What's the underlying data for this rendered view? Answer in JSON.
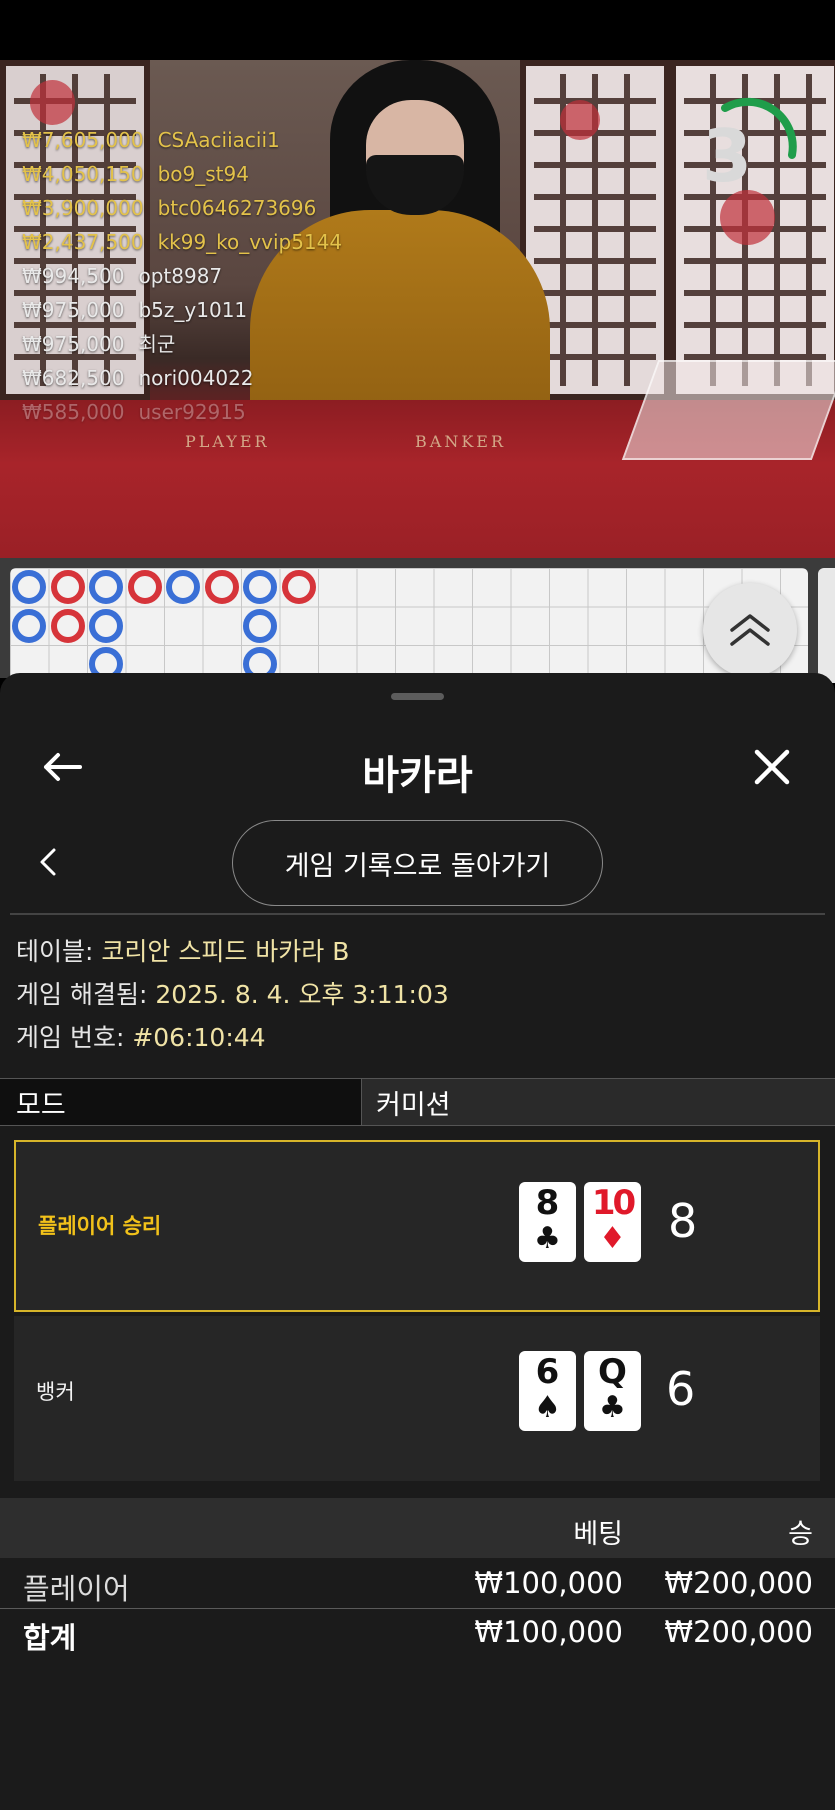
{
  "live_video": {
    "timer_value": "3",
    "table_labels": {
      "player": "PLAYER",
      "banker": "BANKER"
    },
    "bet_feed": [
      {
        "amount": "₩7,605,000",
        "user": "CSAaciiacii1",
        "tone": "gold"
      },
      {
        "amount": "₩4,050,150",
        "user": "bo9_st94",
        "tone": "gold"
      },
      {
        "amount": "₩3,900,000",
        "user": "btc0646273696",
        "tone": "gold"
      },
      {
        "amount": "₩2,437,500",
        "user": "kk99_ko_vvip5144",
        "tone": "gold"
      },
      {
        "amount": "₩994,500",
        "user": "opt8987",
        "tone": "white"
      },
      {
        "amount": "₩975,000",
        "user": "b5z_y1011",
        "tone": "white"
      },
      {
        "amount": "₩975,000",
        "user": "최군",
        "tone": "white"
      },
      {
        "amount": "₩682,500",
        "user": "nori004022",
        "tone": "white"
      },
      {
        "amount": "₩585,000",
        "user": "user92915",
        "tone": "faded"
      }
    ]
  },
  "roadmap": {
    "beads": [
      [
        "P",
        "P"
      ],
      [
        "B",
        "B"
      ],
      [
        "P",
        "P",
        "P"
      ],
      [
        "B"
      ],
      [
        "P"
      ],
      [
        "B"
      ],
      [
        "P",
        "P",
        "P"
      ],
      [
        "B"
      ]
    ],
    "colors": {
      "P": "#3a6fd6",
      "B": "#d6343a"
    }
  },
  "sheet": {
    "title": "바카라",
    "back_icon": "arrow-left-icon",
    "close_icon": "close-icon",
    "history_button": "게임 기록으로 돌아가기",
    "meta": {
      "table_label": "테이블: ",
      "table_value": "코리안 스피드 바카라 B",
      "resolved_label": "게임 해결됨: ",
      "resolved_value": "2025. 8. 4. 오후 3:11:03",
      "number_label": "게임 번호: ",
      "number_value": "#06:10:44"
    },
    "mode": {
      "label": "모드",
      "value": "커미션"
    },
    "results": {
      "player": {
        "label": "플레이어 승리",
        "cards": [
          {
            "rank": "8",
            "suit": "♣",
            "color": "black"
          },
          {
            "rank": "10",
            "suit": "♦",
            "color": "red"
          }
        ],
        "score": "8"
      },
      "banker": {
        "label": "뱅커",
        "cards": [
          {
            "rank": "6",
            "suit": "♠",
            "color": "black"
          },
          {
            "rank": "Q",
            "suit": "♣",
            "color": "black"
          }
        ],
        "score": "6"
      }
    },
    "bets": {
      "col_bet": "베팅",
      "col_win": "승",
      "rows": [
        {
          "name": "플레이어",
          "bet": "₩100,000",
          "win": "₩200,000"
        }
      ],
      "total": {
        "name": "합계",
        "bet": "₩100,000",
        "win": "₩200,000"
      }
    }
  }
}
